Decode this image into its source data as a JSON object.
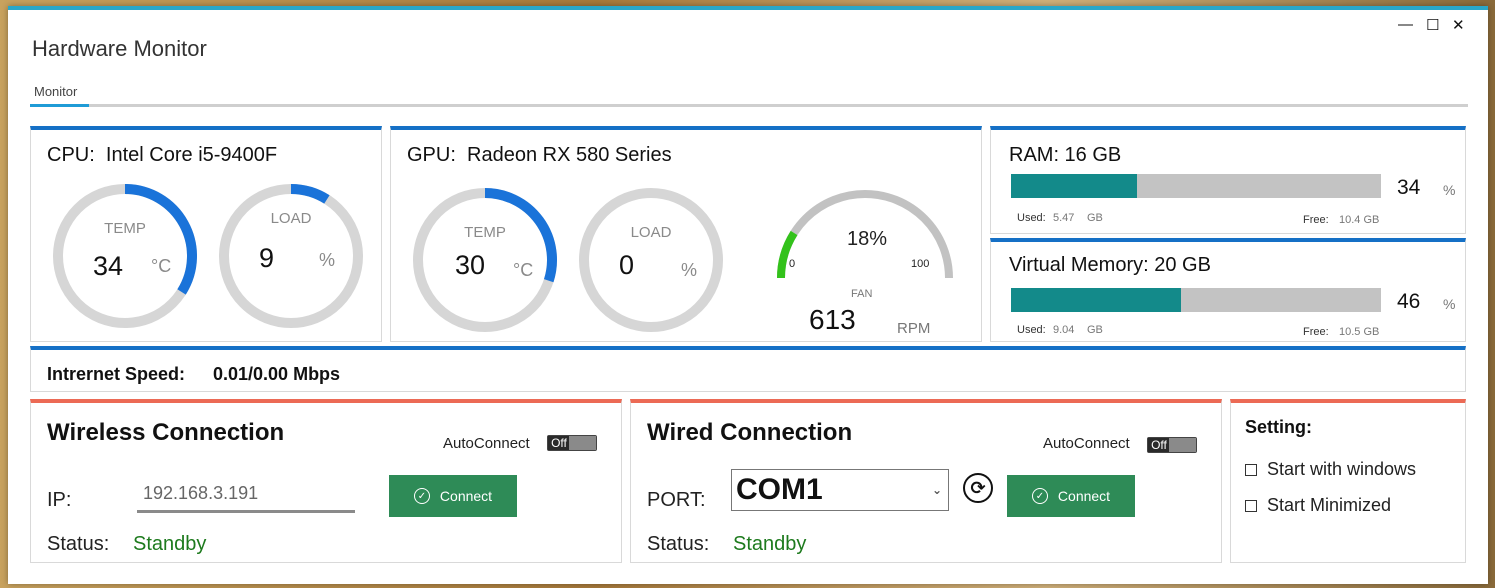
{
  "window": {
    "title": "Hardware Monitor",
    "controls": {
      "minimize": "—",
      "maximize": "☐",
      "close": "✕"
    }
  },
  "tabs": [
    {
      "label": "Monitor",
      "active": true
    }
  ],
  "cpu": {
    "title_prefix": "CPU:",
    "name": "Intel Core i5-9400F",
    "temp": {
      "label": "TEMP",
      "value": "34",
      "unit": "°C",
      "level": 0.34
    },
    "load": {
      "label": "LOAD",
      "value": "9",
      "unit": "%",
      "level": 0.09
    }
  },
  "gpu": {
    "title_prefix": "GPU:",
    "name": "Radeon RX 580 Series",
    "temp": {
      "label": "TEMP",
      "value": "30",
      "unit": "°C",
      "level": 0.3
    },
    "load": {
      "label": "LOAD",
      "value": "0",
      "unit": "%",
      "level": 0.0
    },
    "fan": {
      "percent": "18%",
      "min": "0",
      "max": "100",
      "label": "FAN",
      "rpm": "613",
      "rpm_unit": "RPM",
      "level": 0.18
    }
  },
  "ram": {
    "title": "RAM: 16 GB",
    "percent": "34",
    "percent_unit": "%",
    "level": 0.34,
    "used_label": "Used:",
    "used": "5.47",
    "used_unit": "GB",
    "free_label": "Free:",
    "free": "10.4 GB"
  },
  "virtual_memory": {
    "title": "Virtual Memory: 20 GB",
    "percent": "46",
    "percent_unit": "%",
    "level": 0.46,
    "used_label": "Used:",
    "used": "9.04",
    "used_unit": "GB",
    "free_label": "Free:",
    "free": "10.5 GB"
  },
  "internet": {
    "label": "Intrernet Speed:",
    "value": "0.01/0.00 Mbps"
  },
  "wireless": {
    "title": "Wireless Connection",
    "autoconnect_label": "AutoConnect",
    "toggle_state": "Off",
    "ip_label": "IP:",
    "ip_value": "192.168.3.191",
    "connect_label": "Connect",
    "status_label": "Status:",
    "status_value": "Standby"
  },
  "wired": {
    "title": "Wired Connection",
    "autoconnect_label": "AutoConnect",
    "toggle_state": "Off",
    "port_label": "PORT:",
    "port_value": "COM1",
    "connect_label": "Connect",
    "status_label": "Status:",
    "status_value": "Standby"
  },
  "settings": {
    "title": "Setting:",
    "options": [
      {
        "label": "Start with windows",
        "checked": false
      },
      {
        "label": "Start Minimized",
        "checked": false
      }
    ]
  },
  "colors": {
    "accent_blue": "#1570c6",
    "accent_red": "#ec6a55",
    "gauge_blue": "#1a73d9",
    "gauge_track": "#d6d6d6",
    "bar_fill": "#138a8a",
    "fan_green": "#33c21b",
    "button_green": "#2e8b57",
    "status_green": "#1d7a1d"
  }
}
